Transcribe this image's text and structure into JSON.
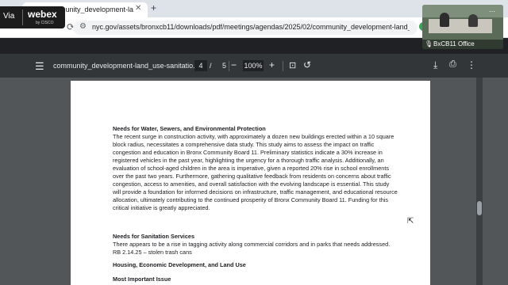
{
  "browser": {
    "tab_title": "community_development-land_use...",
    "url": "nyc.gov/assets/bronxcb11/downloads/pdf/meetings/agendas/2025/02/community_development-land_use-s..."
  },
  "webex": {
    "via": "Via",
    "logo": "webex",
    "sub": "by CISCO"
  },
  "video": {
    "name": "BxCB11 Office"
  },
  "pdf_toolbar": {
    "title": "community_development-land_use-sanitatio...",
    "page_current": "4",
    "page_sep": "/",
    "page_total": "5",
    "zoom": "100%"
  },
  "document": {
    "heading1": "Needs for Water, Sewers, and Environmental Protection",
    "para1": "The recent surge in construction activity, with approximately a dozen new buildings erected within a 10 square block radius, necessitates a comprehensive data study. This study aims to assess the impact on traffic congestion and education in Bronx Community Board 11. Preliminary statistics indicate a 30% increase in registered vehicles in the past year, highlighting the urgency for a thorough traffic analysis. Additionally, an evaluation of school-aged children in the area is imperative, given a reported 20% rise in school enrollments over the past two years. Furthermore, gathering qualitative feedback from residents on concerns about traffic congestion, access to amenities, and overall satisfaction with the evolving landscape is essential. This study will provide a foundation for informed decisions on infrastructure, traffic management, and educational resource allocation, ultimately contributing to the continued prosperity of Bronx Community Board 11. Funding for this critical initiative is greatly appreciated.",
    "heading2": "Needs for Sanitation Services",
    "para2": "There appears to be a rise in tagging activity along commercial corridors and in parks that needs addressed. RB 2.14.25 – stolen trash cans",
    "heading3": "Housing, Economic Development, and Land Use",
    "heading4": "Most Important Issue"
  }
}
